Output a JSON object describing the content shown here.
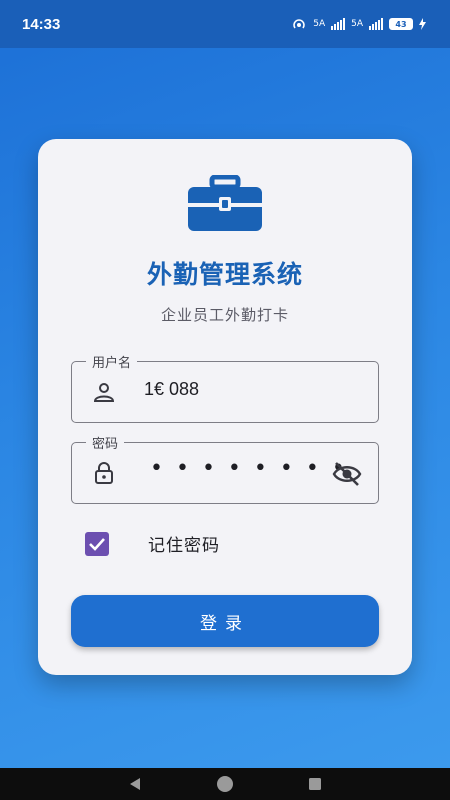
{
  "status_bar": {
    "time": "14:33",
    "network_1": "5A",
    "network_2": "5A",
    "battery": "43"
  },
  "login_card": {
    "app_title": "外勤管理系统",
    "app_subtitle": "企业员工外勤打卡",
    "username": {
      "label": "用户名",
      "value": "1€          088"
    },
    "password": {
      "label": "密码",
      "masked_value": "••••••••"
    },
    "remember": {
      "label": "记住密码",
      "checked": true
    },
    "login_button_label": "登录"
  },
  "colors": {
    "primary": "#1f6fd0",
    "title": "#1a62b5",
    "checkbox": "#6c4fb0",
    "card_bg": "#f3f3f7"
  },
  "icons": {
    "app": "briefcase-icon",
    "user": "person-icon",
    "lock": "lock-icon",
    "visibility": "eye-off-icon"
  }
}
